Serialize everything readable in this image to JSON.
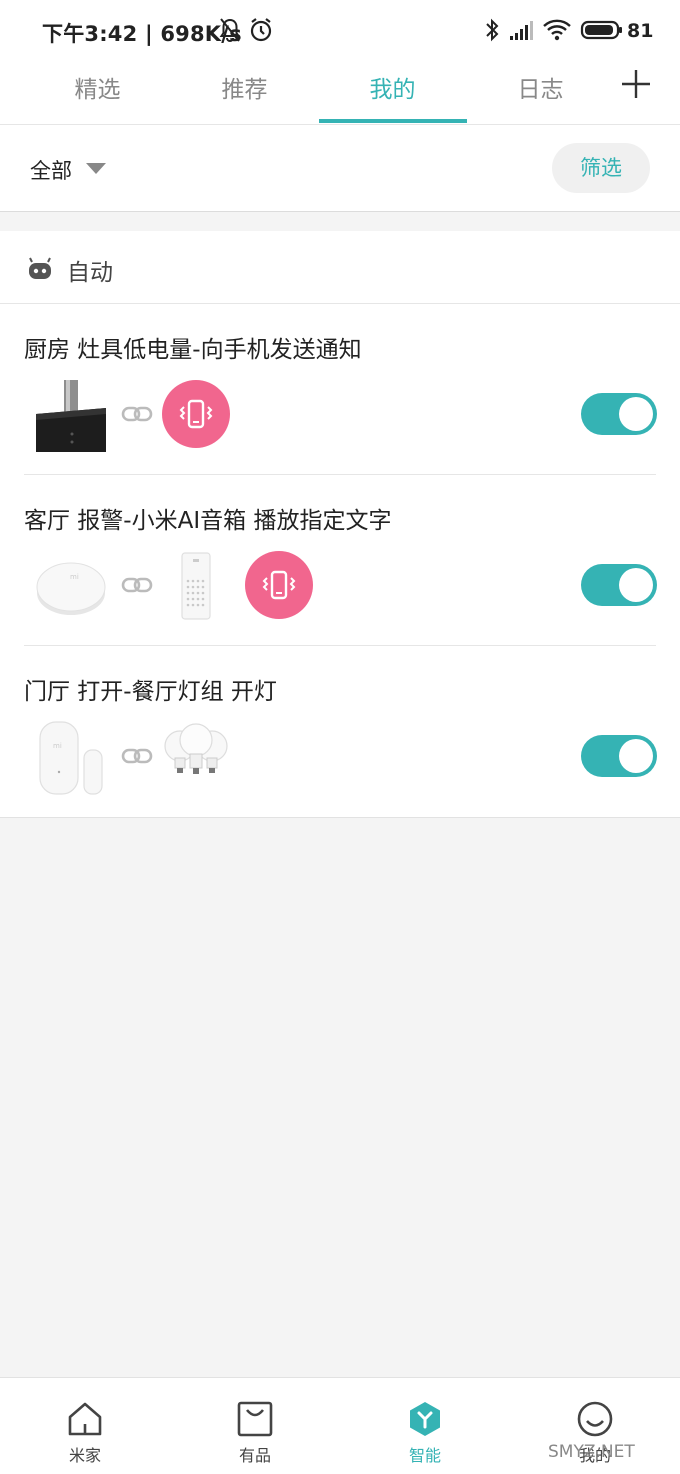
{
  "status_bar": {
    "time_speed": "下午3:42 | 698K/s",
    "battery": "81"
  },
  "tabs": [
    {
      "label": "精选"
    },
    {
      "label": "推荐"
    },
    {
      "label": "我的"
    },
    {
      "label": "日志"
    }
  ],
  "active_tab": "我的",
  "filter": {
    "scope": "全部",
    "button": "筛选"
  },
  "section": {
    "title": "自动",
    "rules": [
      {
        "name": "厨房 灶具低电量-向手机发送通知",
        "enabled": true
      },
      {
        "name": "客厅 报警-小米AI音箱 播放指定文字",
        "enabled": true
      },
      {
        "name": "门厅 打开-餐厅灯组 开灯",
        "enabled": true
      }
    ]
  },
  "bottom_nav": [
    {
      "label": "米家",
      "icon": "home-icon"
    },
    {
      "label": "有品",
      "icon": "shop-bag-icon"
    },
    {
      "label": "智能",
      "icon": "smart-hexagon-icon"
    },
    {
      "label": "我的",
      "icon": "profile-smile-icon"
    }
  ],
  "watermark": "SMYZ.NET",
  "colors": {
    "accent": "#35b3b4",
    "phone_badge": "#f1668e"
  }
}
